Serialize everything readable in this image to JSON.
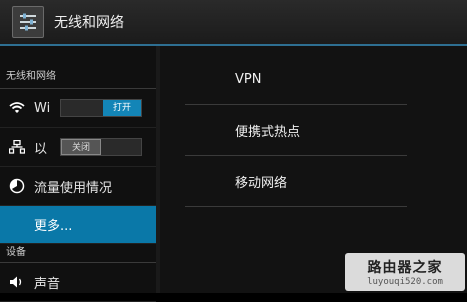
{
  "actionbar": {
    "title": "无线和网络",
    "icon": "settings-sliders-icon"
  },
  "sidebar": {
    "section_wireless": "无线和网络",
    "items": [
      {
        "label": "Wi",
        "icon": "wifi-icon",
        "toggle": "打开"
      },
      {
        "label": "以",
        "icon": "ethernet-icon",
        "toggle": "关闭"
      },
      {
        "label": "流量使用情况",
        "icon": "data-usage-icon"
      },
      {
        "label": "更多...",
        "selected": true
      }
    ],
    "section_device": "设备",
    "partial_item": {
      "label": "声音",
      "icon": "volume-icon"
    }
  },
  "main": {
    "items": [
      {
        "label": "VPN"
      },
      {
        "label": "便携式热点"
      },
      {
        "label": "移动网络"
      }
    ]
  },
  "watermark": {
    "title": "路由器之家",
    "url": "luyouqi520.com"
  },
  "colors": {
    "accent": "#0a78a8",
    "toggle_on": "#1385b7",
    "actionbar_line": "#2e6f92"
  }
}
